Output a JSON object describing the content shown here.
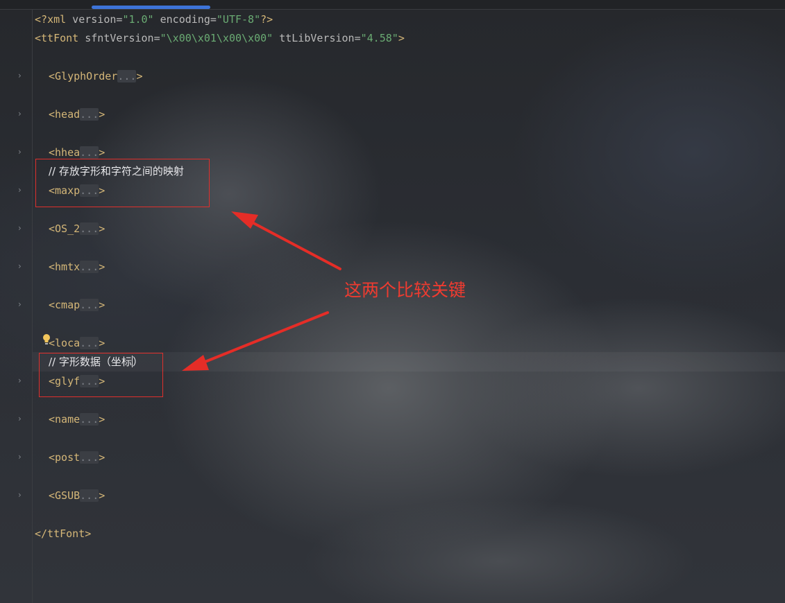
{
  "xml_decl": {
    "open": "<?",
    "name": "xml",
    "attr1_name": " version=",
    "attr1_value": "\"1.0\"",
    "attr2_name": " encoding=",
    "attr2_value": "\"UTF-8\"",
    "close": "?>"
  },
  "root_open": {
    "tag": "<ttFont",
    "attr1_name": " sfntVersion=",
    "attr1_value": "\"\\x00\\x01\\x00\\x00\"",
    "attr2_name": " ttLibVersion=",
    "attr2_value": "\"4.58\"",
    "close": ">"
  },
  "collapsed_tags": [
    {
      "tag": "<GlyphOrder",
      "fold": "...",
      "close": ">"
    },
    {
      "tag": "<head",
      "fold": "...",
      "close": ">"
    },
    {
      "tag": "<hhea",
      "fold": "...",
      "close": ">"
    },
    {
      "tag": "<maxp",
      "fold": "...",
      "close": ">"
    },
    {
      "tag": "<OS_2",
      "fold": "...",
      "close": ">"
    },
    {
      "tag": "<hmtx",
      "fold": "...",
      "close": ">"
    },
    {
      "tag": "<cmap",
      "fold": "...",
      "close": ">"
    },
    {
      "tag": "<loca",
      "fold": "...",
      "close": ">"
    },
    {
      "tag": "<glyf",
      "fold": "...",
      "close": ">"
    },
    {
      "tag": "<name",
      "fold": "...",
      "close": ">"
    },
    {
      "tag": "<post",
      "fold": "...",
      "close": ">"
    },
    {
      "tag": "<GSUB",
      "fold": "...",
      "close": ">"
    }
  ],
  "comments": {
    "maxp_comment": "// 存放字形和字符之间的映射",
    "glyf_comment_before_cursor": "// 字形数据（坐标",
    "glyf_comment_after_cursor": "）"
  },
  "root_close": "</ttFont>",
  "annotation_text": "这两个比较关键",
  "colors": {
    "tag": "#d5b778",
    "string": "#6aab73",
    "annotation": "#ef3b30",
    "tab_indicator": "#3d74d9"
  },
  "icons": [
    "chevron-right-icon",
    "lightbulb-icon"
  ]
}
